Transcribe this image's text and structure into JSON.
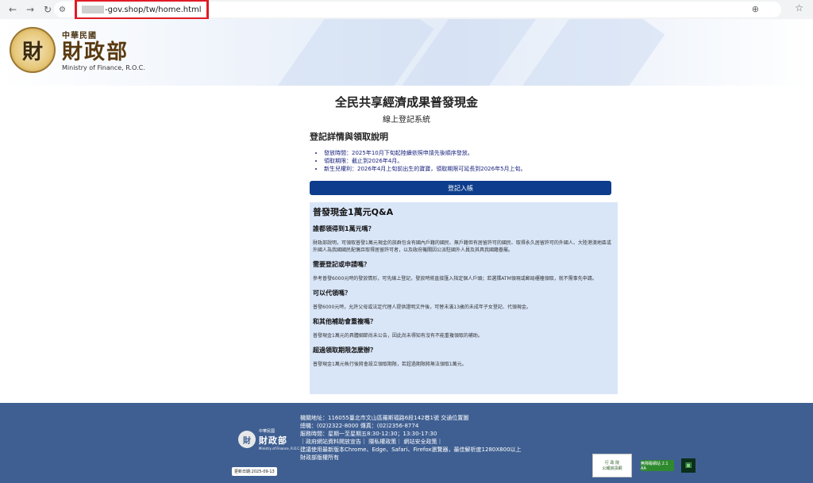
{
  "browser": {
    "back_icon": "←",
    "forward_icon": "→",
    "reload_icon": "↻",
    "site_info_icon": "⚙",
    "url": "-gov.shop/tw/home.html",
    "zoom_icon": "⊕",
    "star_icon": "☆"
  },
  "header": {
    "seal_char": "財",
    "org_small": "中華民國",
    "org_big": "財政部",
    "org_en": "Ministry of Finance, R.O.C."
  },
  "main": {
    "title": "全民共享經濟成果普發現金",
    "subtitle": "線上登記系統",
    "section_title": "登記詳情與領取說明",
    "bullets": [
      "發放時間：2025年10月下旬起陸續依照申請先後順序發放。",
      "領取期限：截止到2026年4月。",
      "新生兒權利：2026年4月上旬前出生的寶寶，領取期限可延長到2026年5月上旬。"
    ],
    "register_button": "登記入帳",
    "qa": {
      "title": "普發現金1萬元Q&A",
      "items": [
        {
          "q": "誰都領得到1萬元嗎？",
          "a": "財政部說明，可領取普發1萬元現金的族群包含有國內戶籍的國民、無戶籍但有居留許可的國民、取得永久居留許可的外國人、大陸港澳地區或外國人為我國國民配偶且取得居留許可者，以及政府機關因公派駐國外人員及其具我國籍眷屬。"
        },
        {
          "q": "需要登記或申請嗎？",
          "a": "參考普發6000元時的發放情形，可先線上登記，發放時將直接匯入指定個人戶頭；若選擇ATM領現或郵局櫃檯領取，就不需事先申請。"
        },
        {
          "q": "可以代領嗎？",
          "a": "普發6000元時，允許父母或法定代理人提供證明文件後，可替未滿13歲的未成年子女登記、代領現金。"
        },
        {
          "q": "和其他補助會重複嗎？",
          "a": "普發現金1萬元的具體細節尚未公告，因此尚未得知有沒有不能重複領取的補助。"
        },
        {
          "q": "超過領取期限怎麼辦？",
          "a": "普發現金1萬元執行後將會設立領取期限，若超過期限將無法領取1萬元。"
        }
      ]
    }
  },
  "footer": {
    "seal_char": "財",
    "org_small": "中華民國",
    "org_big": "財政部",
    "org_en": "Ministry of Finance, R.O.C.",
    "lines": [
      "機關地址：116055臺北市文山區羅斯福路6段142巷1號 交通位置圖",
      "總機：(02)2322-8000 傳真：(02)2356-8774",
      "服務時間：星期一至星期五8:30-12:30；13:30-17:30",
      "｜政府網站資料開放宣告｜ 隱私權政策｜ 網站安全政策｜",
      "建議使用最新版本Chrome、Edge、Safari、Firefox瀏覽器，最佳解析度1280X800以上",
      "財政部版權所有"
    ],
    "update_date": "更新日期:2025-09-13",
    "badge1_top": "行 政 院",
    "badge1_bottom": "公報資訊網",
    "badge2": "無障礙網站 2.1 AA",
    "badge3": "▣"
  }
}
